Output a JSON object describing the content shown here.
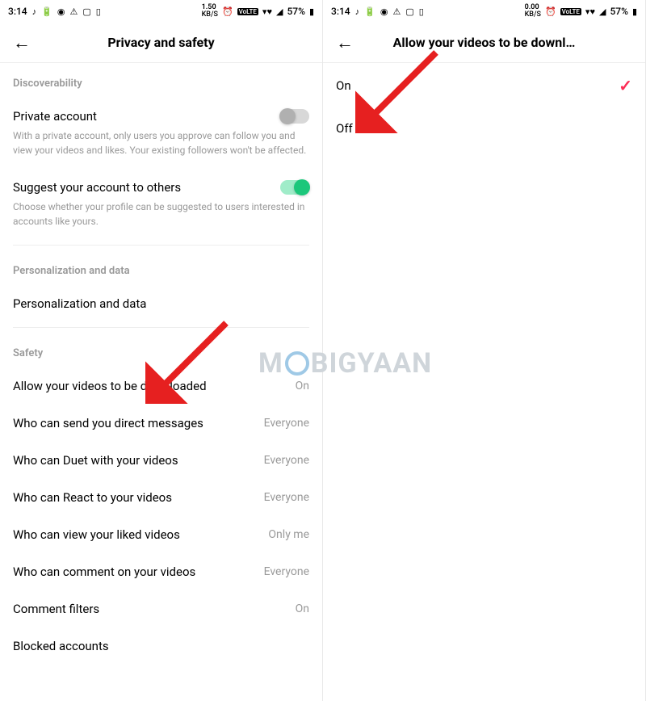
{
  "statusbar": {
    "time": "3:14",
    "kbs_left": "1.50",
    "kbs_right": "0.00",
    "kbs_unit": "KB/S",
    "volte": "VoLTE",
    "battery": "57%"
  },
  "left": {
    "title": "Privacy and safety",
    "sections": {
      "discover_title": "Discoverability",
      "private_account": {
        "label": "Private account",
        "desc": "With a private account, only users you approve can follow you and view your videos and likes. Your existing followers won't be affected.",
        "state": "off"
      },
      "suggest": {
        "label": "Suggest your account to others",
        "desc": "Choose whether your profile can be suggested to users interested in accounts like yours.",
        "state": "on"
      },
      "personalization_title": "Personalization and data",
      "personalization_label": "Personalization and data",
      "safety_title": "Safety",
      "items": [
        {
          "label": "Allow your videos to be downloaded",
          "value": "On"
        },
        {
          "label": "Who can send you direct messages",
          "value": "Everyone"
        },
        {
          "label": "Who can Duet with your videos",
          "value": "Everyone"
        },
        {
          "label": "Who can React to your videos",
          "value": "Everyone"
        },
        {
          "label": "Who can view your liked videos",
          "value": "Only me"
        },
        {
          "label": "Who can comment on your videos",
          "value": "Everyone"
        },
        {
          "label": "Comment filters",
          "value": "On"
        },
        {
          "label": "Blocked accounts",
          "value": ""
        }
      ]
    }
  },
  "right": {
    "title": "Allow your videos to be downl…",
    "options": {
      "on": "On",
      "off": "Off"
    },
    "selected": "on"
  },
  "watermark": {
    "pre": "M",
    "post": "BIGYAAN"
  }
}
